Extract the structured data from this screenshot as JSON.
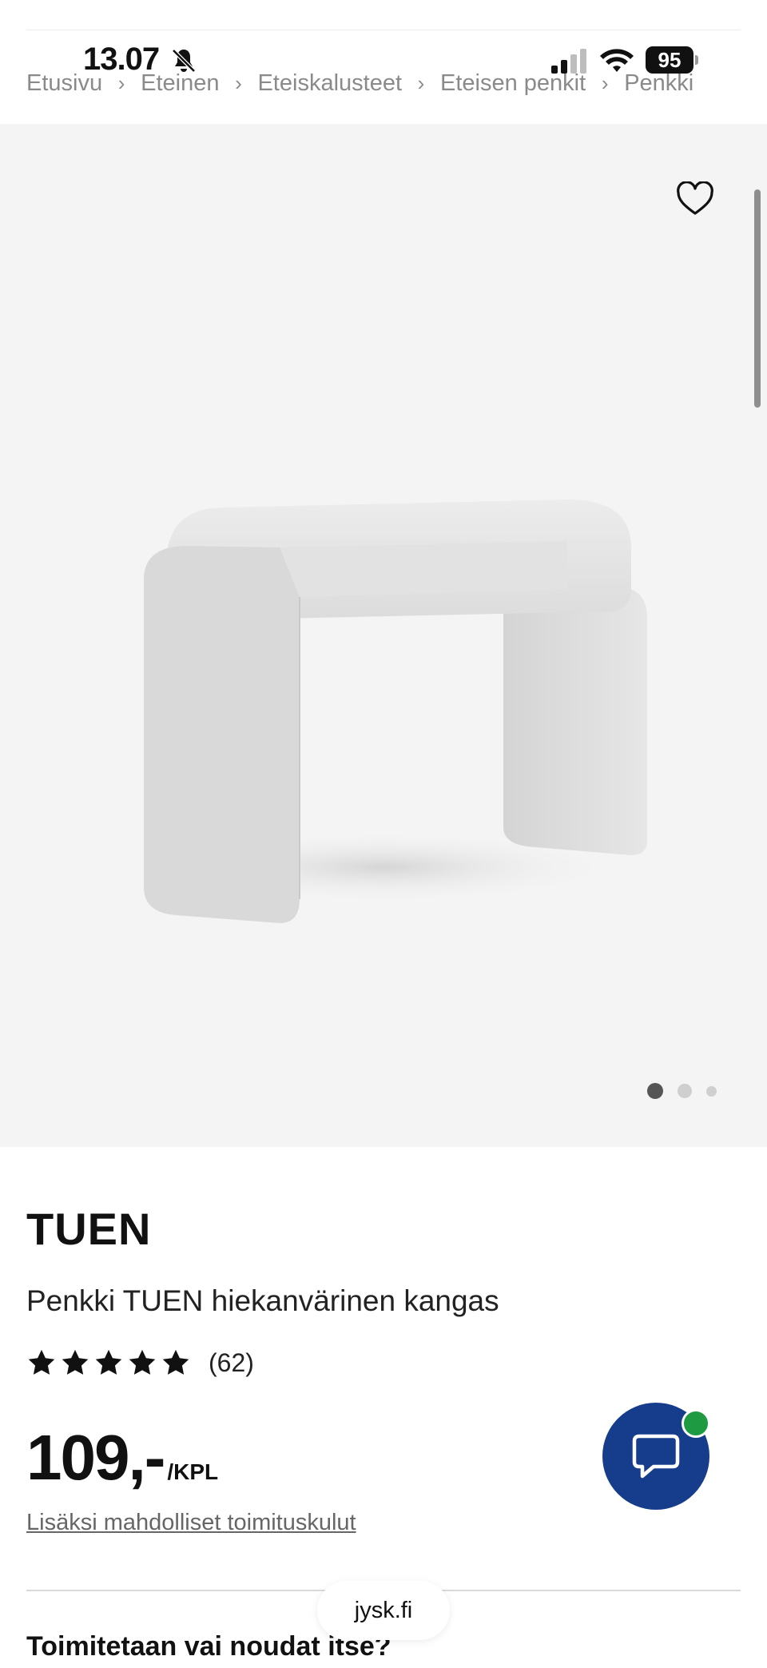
{
  "status_bar": {
    "time": "13.07",
    "battery": "95",
    "muted": true
  },
  "breadcrumb": [
    "Etusivu",
    "Eteinen",
    "Eteiskalusteet",
    "Eteisen penkit",
    "Penkki"
  ],
  "gallery": {
    "image_count": 3,
    "active_index": 0,
    "image_description": "Light grey upholstered bench"
  },
  "product": {
    "brand": "TUEN",
    "name": "Penkki TUEN hiekanvärinen kangas",
    "rating_stars": 5,
    "rating_count": "(62)",
    "price": "109,-",
    "price_unit": "/KPL",
    "delivery_note": "Lisäksi mahdolliset toimituskulut"
  },
  "delivery": {
    "title": "Toimitetaan vai noudat itse?"
  },
  "browser": {
    "url": "jysk.fi"
  },
  "colors": {
    "accent": "#163d8c",
    "online": "#1e9a43",
    "gallery_bg": "#f4f4f4"
  }
}
